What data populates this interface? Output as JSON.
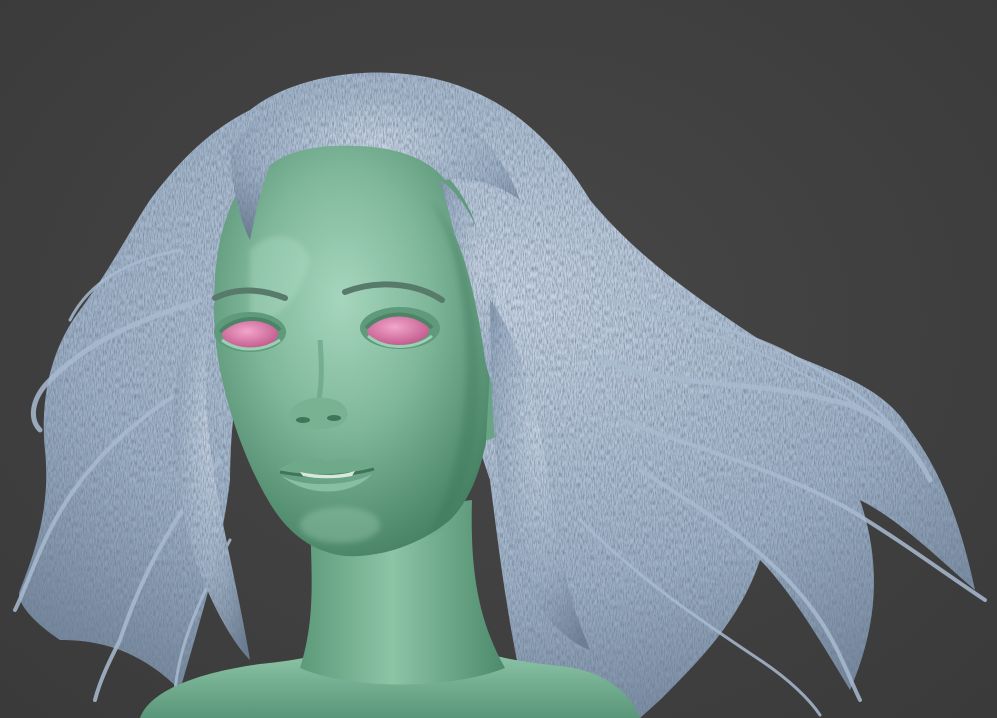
{
  "scene": {
    "background_color": "#414141",
    "model": {
      "skin_color": "#7fb79a",
      "skin_shadow_color": "#4f8a6c",
      "hair_color": "#b7c8dc",
      "hair_shadow_color": "#5d6f84",
      "eye_color": "#e183b0"
    }
  }
}
